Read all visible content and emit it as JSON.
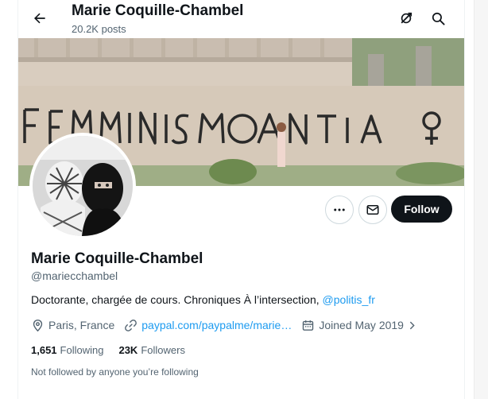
{
  "header": {
    "title": "Marie Coquille-Chambel",
    "subtitle": "20.2K posts"
  },
  "actions": {
    "follow_label": "Follow"
  },
  "profile": {
    "name": "Marie Coquille-Chambel",
    "handle": "@mariecchambel",
    "bio_text": "Doctorante, chargée de cours. Chroniques À l’intersection, ",
    "bio_mention": "@politis_fr",
    "location": "Paris, France",
    "link": "paypal.com/paypalme/marie…",
    "joined": "Joined May 2019"
  },
  "stats": {
    "following_count": "1,651",
    "following_label": "Following",
    "followers_count": "23K",
    "followers_label": "Followers"
  },
  "followed_by_note": "Not followed by anyone you’re following",
  "colors": {
    "accent": "#1d9bf0",
    "text": "#0f1419",
    "secondary": "#536471",
    "button_dark": "#0f1419"
  },
  "icons": {
    "back": "arrow-left-icon",
    "grok": "grok-icon",
    "search": "search-icon",
    "more": "more-dots-icon",
    "message": "envelope-icon",
    "location": "location-pin-icon",
    "link": "link-icon",
    "calendar": "calendar-icon",
    "chevron": "chevron-right-icon"
  }
}
